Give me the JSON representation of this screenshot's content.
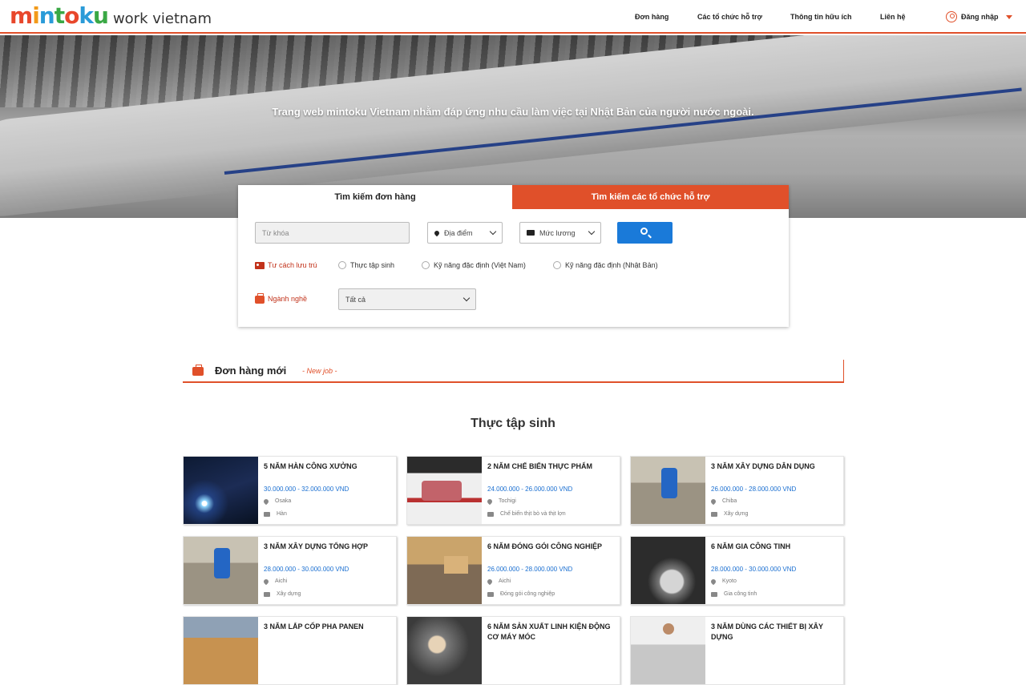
{
  "brand": {
    "logo_main": "mintoku",
    "logo_sub": "work vietnam",
    "accent_color": "#e0502a",
    "link_color": "#1a6fd1"
  },
  "nav": {
    "orders": "Đơn hàng",
    "support_orgs": "Các tổ chức hỗ trợ",
    "useful_info": "Thông tin hữu ích",
    "contact": "Liên hệ",
    "login": "Đăng nhập"
  },
  "hero": {
    "tagline": "Trang web mintoku Vietnam nhằm đáp ứng nhu cầu làm việc tại Nhật Bản của người nước ngoài."
  },
  "search": {
    "tab_jobs": "Tìm kiếm đơn hàng",
    "tab_orgs": "Tìm kiếm các tổ chức hỗ trợ",
    "keyword_placeholder": "Từ khóa",
    "location": "Địa điểm",
    "salary": "Mức lương",
    "residence_label": "Tư cách lưu trú",
    "residence_options": [
      "Thực tập sinh",
      "Kỹ năng đặc định (Việt Nam)",
      "Kỹ năng đặc định (Nhật Bản)"
    ],
    "industry_label": "Ngành nghề",
    "industry_value": "Tất cả"
  },
  "section": {
    "title": "Đơn hàng mới",
    "subtitle": "- New job -"
  },
  "category_title": "Thực tập sinh",
  "jobs": [
    {
      "title": "5 NĂM HÀN CÔNG XƯỞNG",
      "salary": "30.000.000 - 32.000.000 VND",
      "location": "Osaka",
      "industry": "Hàn"
    },
    {
      "title": "2 NĂM CHẾ BIẾN THỰC PHẨM",
      "salary": "24.000.000 - 26.000.000 VND",
      "location": "Tochigi",
      "industry": "Chế biến thịt bò và thịt lợn"
    },
    {
      "title": "3 NĂM XÂY DỰNG DÂN DỤNG",
      "salary": "26.000.000 - 28.000.000 VND",
      "location": "Chiba",
      "industry": "Xây dựng"
    },
    {
      "title": "3 NĂM XÂY DỰNG TỔNG HỢP",
      "salary": "28.000.000 - 30.000.000 VND",
      "location": "Aichi",
      "industry": "Xây dựng"
    },
    {
      "title": "6 NĂM ĐÓNG GÓI CÔNG NGHIỆP",
      "salary": "26.000.000 - 28.000.000 VND",
      "location": "Aichi",
      "industry": "Đóng gói công nghiệp"
    },
    {
      "title": "6 NĂM GIA CÔNG TINH",
      "salary": "28.000.000 - 30.000.000 VND",
      "location": "Kyoto",
      "industry": "Gia công tinh"
    },
    {
      "title": "3 NĂM LẮP CỐP PHA PANEN",
      "salary": "",
      "location": "",
      "industry": ""
    },
    {
      "title": "6 NĂM SẢN XUẤT LINH KIỆN ĐỘNG CƠ MÁY MÓC",
      "salary": "",
      "location": "",
      "industry": ""
    },
    {
      "title": "3 NĂM DÙNG CÁC THIẾT BỊ XÂY DỰNG",
      "salary": "",
      "location": "",
      "industry": ""
    }
  ]
}
